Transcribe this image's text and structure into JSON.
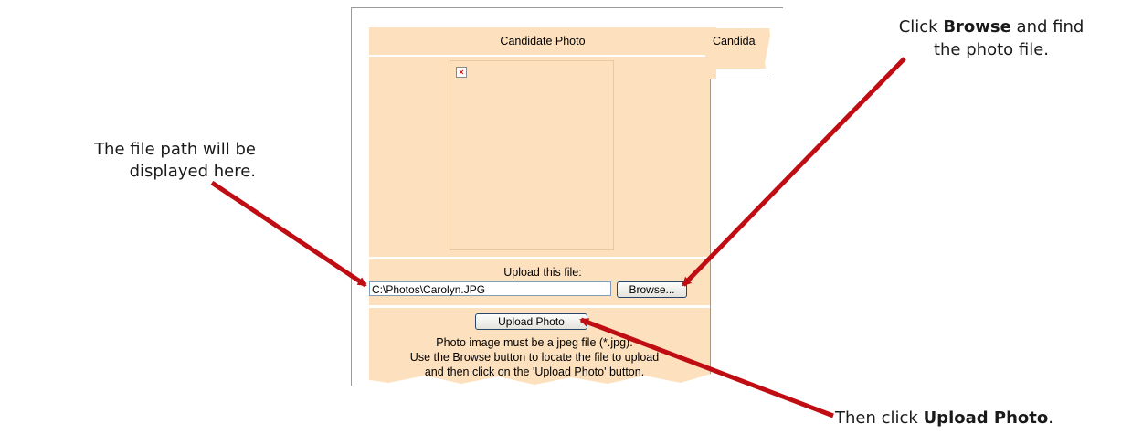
{
  "panel": {
    "title": "Candidate Photo",
    "upload_label": "Upload this file:",
    "file_value": "C:\\Photos\\Carolyn.JPG",
    "browse_label": "Browse...",
    "upload_button": "Upload Photo",
    "note_line1": "Photo image must be a jpeg file (*.jpg).",
    "note_line2": "Use the Browse button to locate the file to upload",
    "note_line3": "and then click on the 'Upload Photo' button."
  },
  "right_panel": {
    "title_partial": "Candida"
  },
  "callouts": {
    "file_path_line1": "The file path will be",
    "file_path_line2": "displayed here.",
    "browse_pre": "Click ",
    "browse_bold": "Browse",
    "browse_post": " and find",
    "browse_line2": "the photo file.",
    "upload_pre": "Then click ",
    "upload_bold": "Upload Photo",
    "upload_post": "."
  },
  "colors": {
    "panel_bg": "#fde0bd",
    "arrow": "#c00d14"
  }
}
